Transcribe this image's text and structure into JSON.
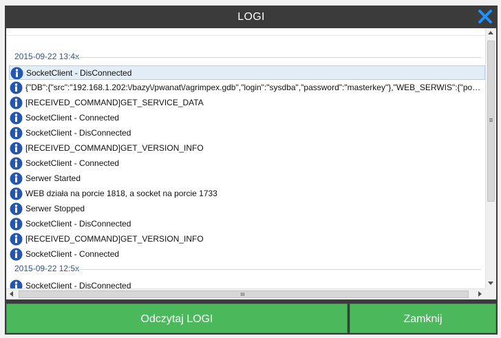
{
  "window": {
    "title": "LOGI"
  },
  "log": {
    "groups": [
      {
        "label": "2015-09-22 13:4x"
      },
      {
        "label": "2015-09-22 12:5x"
      }
    ],
    "rows": [
      {
        "icon": "info-icon",
        "text": "SocketClient - DisConnected",
        "selected": true
      },
      {
        "icon": "info-icon",
        "text": "{\"DB\":{\"src\":\"192.168.1.202:\\/bazy\\/pwanat\\/agrimpex.gdb\",\"login\":\"sysdba\",\"password\":\"masterkey\"},\"WEB_SERWIS\":{\"port\":1818},\"..."
      },
      {
        "icon": "info-icon",
        "text": "[RECEIVED_COMMAND]GET_SERVICE_DATA"
      },
      {
        "icon": "info-icon",
        "text": "SocketClient - Connected"
      },
      {
        "icon": "info-icon",
        "text": "SocketClient - DisConnected"
      },
      {
        "icon": "info-icon",
        "text": "[RECEIVED_COMMAND]GET_VERSION_INFO"
      },
      {
        "icon": "info-icon",
        "text": "SocketClient - Connected"
      },
      {
        "icon": "info-icon",
        "text": "Serwer Started"
      },
      {
        "icon": "info-icon",
        "text": "WEB działa na porcie 1818, a socket na porcie 1733"
      },
      {
        "icon": "info-icon",
        "text": "Serwer Stopped"
      },
      {
        "icon": "info-icon",
        "text": "SocketClient - DisConnected"
      },
      {
        "icon": "info-icon",
        "text": "[RECEIVED_COMMAND]GET_VERSION_INFO"
      },
      {
        "icon": "info-icon",
        "text": "SocketClient - Connected"
      },
      {
        "icon": "info-icon",
        "text": "SocketClient - DisConnected"
      }
    ]
  },
  "buttons": {
    "read_logs": "Odczytaj LOGI",
    "close": "Zamknij"
  },
  "colors": {
    "titlebar": "#3b3b3b",
    "accent_green": "#4cb85c",
    "info_blue": "#2256b5",
    "close_icon": "#1e90ff",
    "group_label": "#2f5597"
  }
}
